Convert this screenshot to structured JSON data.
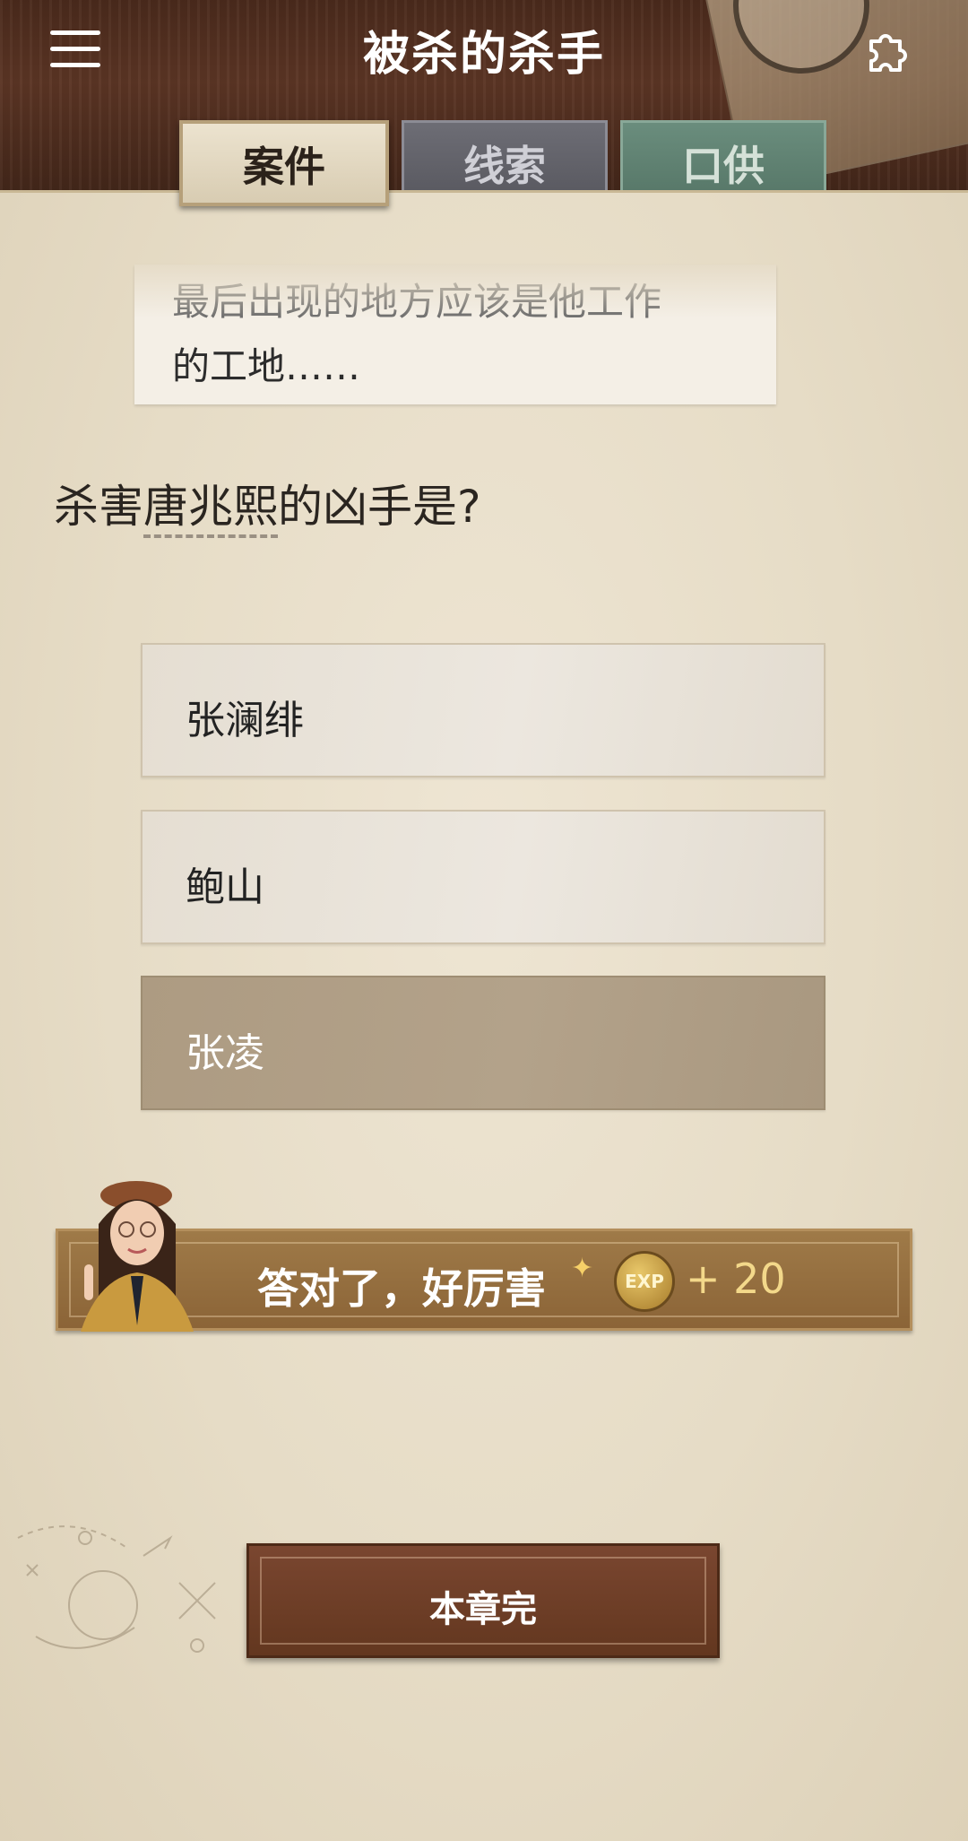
{
  "header": {
    "title": "被杀的杀手",
    "menu_icon": "hamburger-menu-icon",
    "puzzle_icon": "puzzle-piece-icon"
  },
  "tabs": [
    {
      "label": "案件",
      "active": true
    },
    {
      "label": "线索",
      "active": false
    },
    {
      "label": "口供",
      "active": false
    }
  ],
  "story": {
    "line1": "最后出现的地方应该是他工作",
    "line2": "的工地……"
  },
  "question": {
    "prefix": "杀害",
    "name": "唐兆熙",
    "suffix": "的凶手是?"
  },
  "options": [
    {
      "label": "张澜绯",
      "selected": false
    },
    {
      "label": "鲍山",
      "selected": false
    },
    {
      "label": "张凌",
      "selected": true
    }
  ],
  "feedback": {
    "text": "答对了，好厉害",
    "exp_badge": "EXP",
    "exp_value": "+ 20"
  },
  "footer": {
    "chapter_done_label": "本章完"
  },
  "colors": {
    "header_wood": "#4a2a1c",
    "paper": "#e6dcc6",
    "selected_option": "#ad9b82",
    "banner": "#8b6437",
    "button": "#6b3c24"
  }
}
